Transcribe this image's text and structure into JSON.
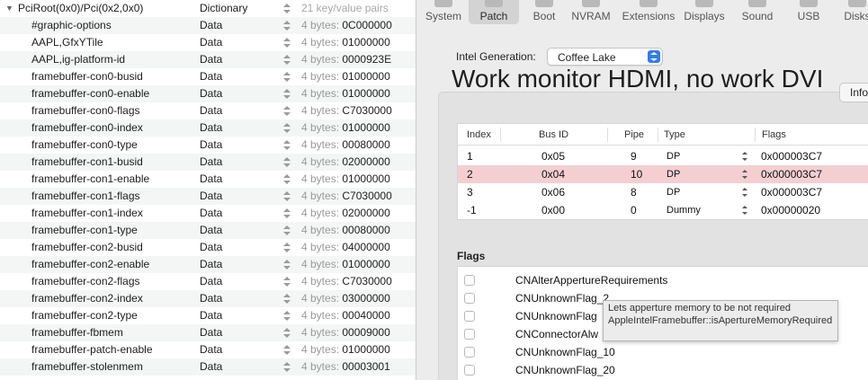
{
  "plist": {
    "root": {
      "key": "PciRoot(0x0)/Pci(0x2,0x0)",
      "type": "Dictionary",
      "value": "21 key/value pairs"
    },
    "rows": [
      {
        "key": "#graphic-options",
        "type": "Data",
        "size": "4 bytes:",
        "value": "0C000000"
      },
      {
        "key": "AAPL,GfxYTile",
        "type": "Data",
        "size": "4 bytes:",
        "value": "01000000"
      },
      {
        "key": "AAPL,ig-platform-id",
        "type": "Data",
        "size": "4 bytes:",
        "value": "0000923E"
      },
      {
        "key": "framebuffer-con0-busid",
        "type": "Data",
        "size": "4 bytes:",
        "value": "01000000"
      },
      {
        "key": "framebuffer-con0-enable",
        "type": "Data",
        "size": "4 bytes:",
        "value": "01000000"
      },
      {
        "key": "framebuffer-con0-flags",
        "type": "Data",
        "size": "4 bytes:",
        "value": "C7030000"
      },
      {
        "key": "framebuffer-con0-index",
        "type": "Data",
        "size": "4 bytes:",
        "value": "01000000"
      },
      {
        "key": "framebuffer-con0-type",
        "type": "Data",
        "size": "4 bytes:",
        "value": "00080000"
      },
      {
        "key": "framebuffer-con1-busid",
        "type": "Data",
        "size": "4 bytes:",
        "value": "02000000"
      },
      {
        "key": "framebuffer-con1-enable",
        "type": "Data",
        "size": "4 bytes:",
        "value": "01000000"
      },
      {
        "key": "framebuffer-con1-flags",
        "type": "Data",
        "size": "4 bytes:",
        "value": "C7030000"
      },
      {
        "key": "framebuffer-con1-index",
        "type": "Data",
        "size": "4 bytes:",
        "value": "02000000"
      },
      {
        "key": "framebuffer-con1-type",
        "type": "Data",
        "size": "4 bytes:",
        "value": "00080000"
      },
      {
        "key": "framebuffer-con2-busid",
        "type": "Data",
        "size": "4 bytes:",
        "value": "04000000"
      },
      {
        "key": "framebuffer-con2-enable",
        "type": "Data",
        "size": "4 bytes:",
        "value": "01000000"
      },
      {
        "key": "framebuffer-con2-flags",
        "type": "Data",
        "size": "4 bytes:",
        "value": "C7030000"
      },
      {
        "key": "framebuffer-con2-index",
        "type": "Data",
        "size": "4 bytes:",
        "value": "03000000"
      },
      {
        "key": "framebuffer-con2-type",
        "type": "Data",
        "size": "4 bytes:",
        "value": "00040000"
      },
      {
        "key": "framebuffer-fbmem",
        "type": "Data",
        "size": "4 bytes:",
        "value": "00009000"
      },
      {
        "key": "framebuffer-patch-enable",
        "type": "Data",
        "size": "4 bytes:",
        "value": "01000000"
      },
      {
        "key": "framebuffer-stolenmem",
        "type": "Data",
        "size": "4 bytes:",
        "value": "00003001"
      }
    ]
  },
  "toolbar": {
    "tabs": [
      {
        "label": "System",
        "icon": "system-icon"
      },
      {
        "label": "Patch",
        "icon": "patch-icon",
        "selected": true
      },
      {
        "label": "Boot",
        "icon": "boot-icon"
      },
      {
        "label": "NVRAM",
        "icon": "nvram-icon"
      },
      {
        "label": "Extensions",
        "icon": "extensions-icon"
      },
      {
        "label": "Displays",
        "icon": "displays-icon"
      },
      {
        "label": "Sound",
        "icon": "sound-icon"
      },
      {
        "label": "USB",
        "icon": "usb-icon"
      },
      {
        "label": "Disks",
        "icon": "disks-icon"
      }
    ]
  },
  "generation": {
    "label": "Intel Generation:",
    "value": "Coffee Lake"
  },
  "status_title": "Work monitor HDMI, no work DVI",
  "info_tab": "Info",
  "connectors": {
    "headers": {
      "index": "Index",
      "bus_id": "Bus ID",
      "pipe": "Pipe",
      "type": "Type",
      "flags": "Flags"
    },
    "rows": [
      {
        "index": "1",
        "bus_id": "0x05",
        "pipe": "9",
        "type": "DP",
        "flags": "0x000003C7",
        "selected": false
      },
      {
        "index": "2",
        "bus_id": "0x04",
        "pipe": "10",
        "type": "DP",
        "flags": "0x000003C7",
        "selected": true
      },
      {
        "index": "3",
        "bus_id": "0x06",
        "pipe": "8",
        "type": "DP",
        "flags": "0x000003C7",
        "selected": false
      },
      {
        "index": "-1",
        "bus_id": "0x00",
        "pipe": "0",
        "type": "Dummy",
        "flags": "0x00000020",
        "selected": false
      }
    ]
  },
  "flags": {
    "label": "Flags",
    "items": [
      {
        "label": "CNAlterAppertureRequirements",
        "checked": false
      },
      {
        "label": "CNUnknownFlag_2",
        "checked": false
      },
      {
        "label": "CNUnknownFlag",
        "checked": false
      },
      {
        "label": "CNConnectorAlw",
        "checked": false
      },
      {
        "label": "CNUnknownFlag_10",
        "checked": false
      },
      {
        "label": "CNUnknownFlag_20",
        "checked": false
      }
    ]
  },
  "tooltip": "Lets apperture memory to be not required AppleIntelFramebuffer::isApertureMemoryRequired"
}
